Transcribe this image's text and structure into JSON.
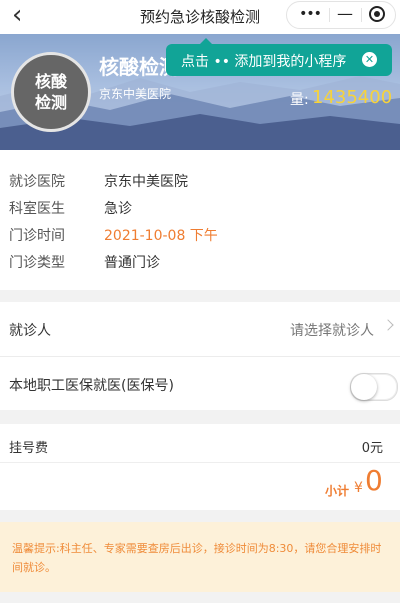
{
  "topbar": {
    "back_icon": "chevron-left-icon",
    "title": "预约急诊核酸检测",
    "capsule": {
      "more_icon": "•••",
      "minimize_icon": "—"
    }
  },
  "banner": {
    "badge_line1": "核酸",
    "badge_line2": "检测",
    "project_name": "核酸检测",
    "hospital": "京东中美医院",
    "sold_label": "量:",
    "sold_value": "1435400",
    "sold_color": "#f7d33a"
  },
  "tooltip": {
    "text": "点击 •• 添加到我的小程序",
    "close_icon": "✕",
    "color": "#11a497"
  },
  "info": {
    "rows": [
      {
        "label": "就诊医院",
        "value": "京东中美医院"
      },
      {
        "label": "科室医生",
        "value": "急诊"
      },
      {
        "label": "门诊时间",
        "value": "2021-10-08 下午"
      },
      {
        "label": "门诊类型",
        "value": "普通门诊"
      }
    ],
    "highlight_color": "#ef7d32"
  },
  "patient": {
    "label": "就诊人",
    "placeholder": "请选择就诊人"
  },
  "insurance": {
    "label": "本地职工医保就医(医保号)",
    "toggle_on": false
  },
  "fee": {
    "label": "挂号费",
    "value": "0元",
    "subtotal_label": "小计",
    "subtotal_currency": "¥",
    "subtotal_value": "0"
  },
  "notice": {
    "text": "温馨提示:科主任、专家需要查房后出诊，接诊时间为8:30，请您合理安排时间就诊。"
  }
}
